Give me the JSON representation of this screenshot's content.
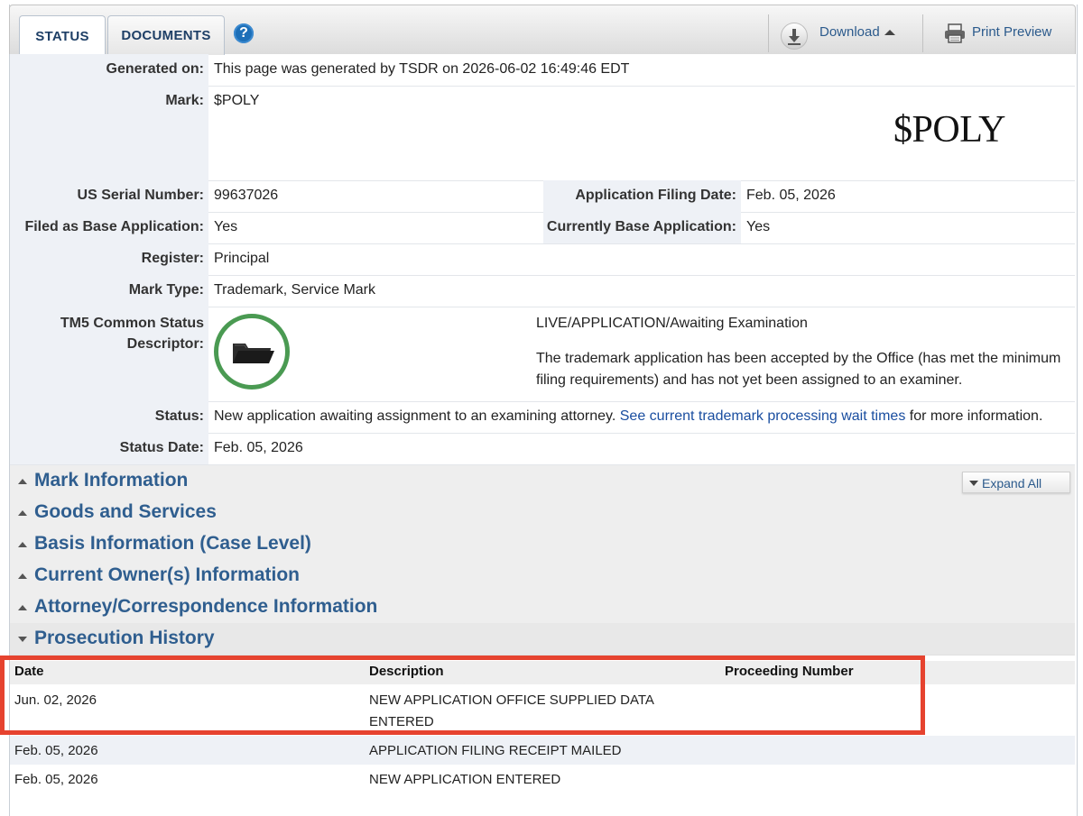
{
  "tabs": {
    "status": "STATUS",
    "documents": "DOCUMENTS",
    "help": "?"
  },
  "toolbar": {
    "download": "Download",
    "print_preview": "Print Preview"
  },
  "status": {
    "generated_on_label": "Generated on:",
    "generated_on_value": "This page was generated by TSDR on 2026-06-02 16:49:46 EDT",
    "mark_label": "Mark:",
    "mark_value": "$POLY",
    "mark_image_text": "$POLY",
    "serial_label": "US Serial Number:",
    "serial_value": "99637026",
    "filing_date_label": "Application Filing Date:",
    "filing_date_value": "Feb. 05, 2026",
    "filed_base_label": "Filed as Base Application:",
    "filed_base_value": "Yes",
    "current_base_label": "Currently Base Application:",
    "current_base_value": "Yes",
    "register_label": "Register:",
    "register_value": "Principal",
    "mark_type_label": "Mark Type:",
    "mark_type_value": "Trademark, Service Mark",
    "tm5_label_line1": "TM5 Common Status",
    "tm5_label_line2": "Descriptor:",
    "tm5_status": "LIVE/APPLICATION/Awaiting Examination",
    "tm5_desc_line1": "The trademark application has been accepted by the Office (has met the minimum",
    "tm5_desc_line2": "filing requirements) and has not yet been assigned to an examiner.",
    "status_label": "Status:",
    "status_text": "New application awaiting assignment to an examining attorney.",
    "status_link": "See current trademark processing wait times",
    "status_suffix": "for more information.",
    "status_date_label": "Status Date:",
    "status_date_value": "Feb. 05, 2026"
  },
  "sections": [
    "Mark Information",
    "Goods and Services",
    "Basis Information (Case Level)",
    "Current Owner(s) Information",
    "Attorney/Correspondence Information",
    "Prosecution History"
  ],
  "expand_all": "Expand All",
  "history": {
    "columns": [
      "Date",
      "Description",
      "Proceeding Number"
    ],
    "rows": [
      {
        "date": "Jun. 02, 2026",
        "desc_line1": "NEW APPLICATION OFFICE SUPPLIED DATA",
        "desc_line2": "ENTERED",
        "proceeding": ""
      },
      {
        "date": "Feb. 05, 2026",
        "desc_line1": "APPLICATION FILING RECEIPT MAILED",
        "desc_line2": "",
        "proceeding": ""
      },
      {
        "date": "Feb. 05, 2026",
        "desc_line1": "NEW APPLICATION ENTERED",
        "desc_line2": "",
        "proceeding": ""
      }
    ]
  },
  "colors": {
    "highlight": "#e6432f",
    "section_title": "#2f5e8f",
    "status_ring": "#4a9a52"
  }
}
